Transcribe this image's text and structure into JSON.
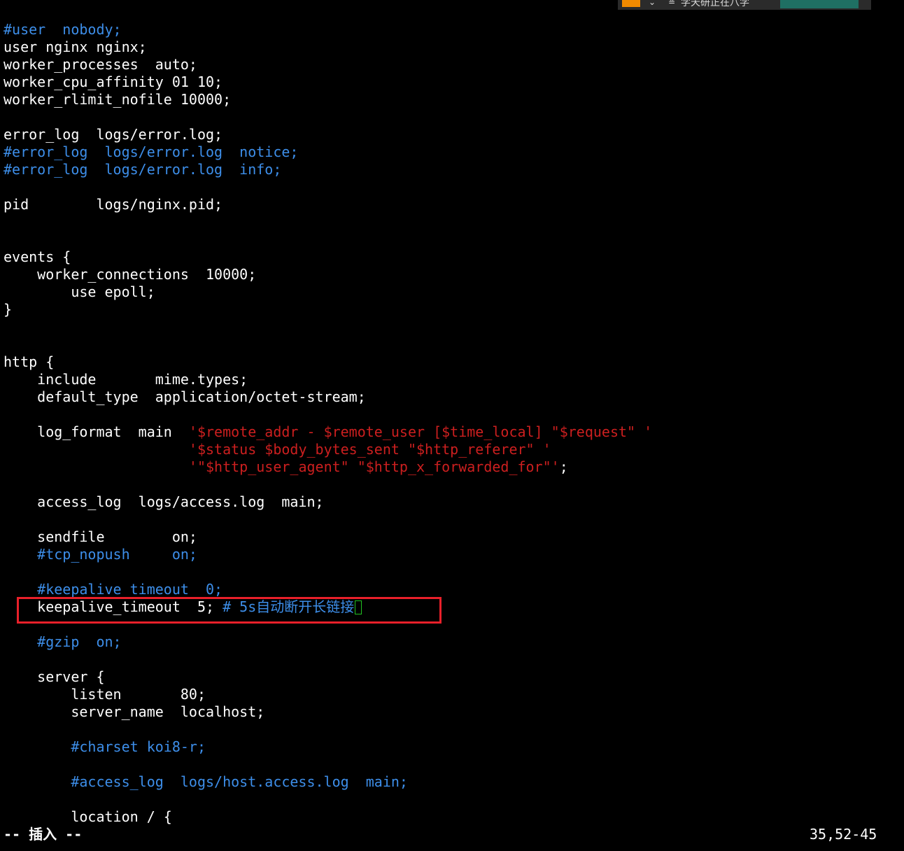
{
  "colors": {
    "background": "#000000",
    "text": "#ffffff",
    "comment": "#3d8ee9",
    "string": "#cc1f1f",
    "cursor": "#22c322",
    "highlight": "#e8202a"
  },
  "taskbar": {
    "label": "学天研正在八学",
    "icons": [
      "app-icon",
      "chevron-down-icon",
      "network-icon"
    ]
  },
  "lines": [
    [
      {
        "t": "#user  nobody;",
        "c": "cmt"
      }
    ],
    [
      {
        "t": "user nginx nginx;",
        "c": "txt"
      }
    ],
    [
      {
        "t": "worker_processes  auto;",
        "c": "txt"
      }
    ],
    [
      {
        "t": "worker_cpu_affinity 01 10;",
        "c": "txt"
      }
    ],
    [
      {
        "t": "worker_rlimit_nofile 10000;",
        "c": "txt"
      }
    ],
    [],
    [
      {
        "t": "error_log  logs/error.log;",
        "c": "txt"
      }
    ],
    [
      {
        "t": "#error_log  logs/error.log  notice;",
        "c": "cmt"
      }
    ],
    [
      {
        "t": "#error_log  logs/error.log  info;",
        "c": "cmt"
      }
    ],
    [],
    [
      {
        "t": "pid        logs/nginx.pid;",
        "c": "txt"
      }
    ],
    [],
    [],
    [
      {
        "t": "events {",
        "c": "txt"
      }
    ],
    [
      {
        "t": "    worker_connections  10000;",
        "c": "txt"
      }
    ],
    [
      {
        "t": "        use epoll;",
        "c": "txt"
      }
    ],
    [
      {
        "t": "}",
        "c": "txt"
      }
    ],
    [],
    [],
    [
      {
        "t": "http {",
        "c": "txt"
      }
    ],
    [
      {
        "t": "    include       mime.types;",
        "c": "txt"
      }
    ],
    [
      {
        "t": "    default_type  application/octet-stream;",
        "c": "txt"
      }
    ],
    [],
    [
      {
        "t": "    log_format  main  ",
        "c": "txt"
      },
      {
        "t": "'$remote_addr - $remote_user [$time_local] \"$request\" '",
        "c": "str"
      }
    ],
    [
      {
        "t": "                      ",
        "c": "txt"
      },
      {
        "t": "'$status $body_bytes_sent \"$http_referer\" '",
        "c": "str"
      }
    ],
    [
      {
        "t": "                      ",
        "c": "txt"
      },
      {
        "t": "'\"$http_user_agent\" \"$http_x_forwarded_for\"'",
        "c": "str"
      },
      {
        "t": ";",
        "c": "txt"
      }
    ],
    [],
    [
      {
        "t": "    access_log  logs/access.log  main;",
        "c": "txt"
      }
    ],
    [],
    [
      {
        "t": "    sendfile        on;",
        "c": "txt"
      }
    ],
    [
      {
        "t": "    #tcp_nopush     on;",
        "c": "cmt"
      }
    ],
    [],
    [
      {
        "t": "    #keepalive_timeout  0;",
        "c": "cmt"
      }
    ],
    [
      {
        "t": "    keepalive_timeout  5; ",
        "c": "txt"
      },
      {
        "t": "# 5s自动断开长链接",
        "c": "cmt"
      },
      {
        "cursor": true
      }
    ],
    [],
    [
      {
        "t": "    #gzip  on;",
        "c": "cmt"
      }
    ],
    [],
    [
      {
        "t": "    server {",
        "c": "txt"
      }
    ],
    [
      {
        "t": "        listen       80;",
        "c": "txt"
      }
    ],
    [
      {
        "t": "        server_name  localhost;",
        "c": "txt"
      }
    ],
    [],
    [
      {
        "t": "        #charset koi8-r;",
        "c": "cmt"
      }
    ],
    [],
    [
      {
        "t": "        #access_log  logs/host.access.log  main;",
        "c": "cmt"
      }
    ],
    [],
    [
      {
        "t": "        location / {",
        "c": "txt"
      }
    ]
  ],
  "statusbar": {
    "mode": "-- 插入 --",
    "position": "35,52-45"
  }
}
